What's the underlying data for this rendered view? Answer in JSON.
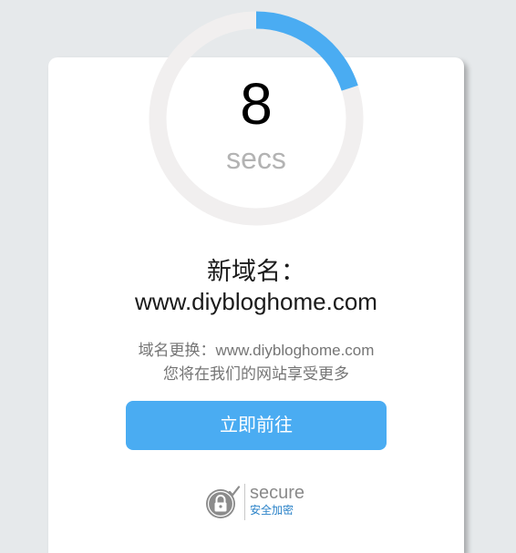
{
  "countdown": {
    "number": "8",
    "unit": "secs",
    "progress_fraction": 0.2,
    "track_color": "#f1efef",
    "progress_color": "#4aacf2"
  },
  "headline": {
    "line1": "新域名：",
    "line2": "www.diybloghome.com"
  },
  "description": {
    "line1": "域名更换：www.diybloghome.com",
    "line2": "您将在我们的网站享受更多"
  },
  "button": {
    "label": "立即前往",
    "color": "#4aacf2"
  },
  "secure_badge": {
    "icon": "lock-check-icon",
    "label": "secure",
    "sub_label": "安全加密"
  }
}
